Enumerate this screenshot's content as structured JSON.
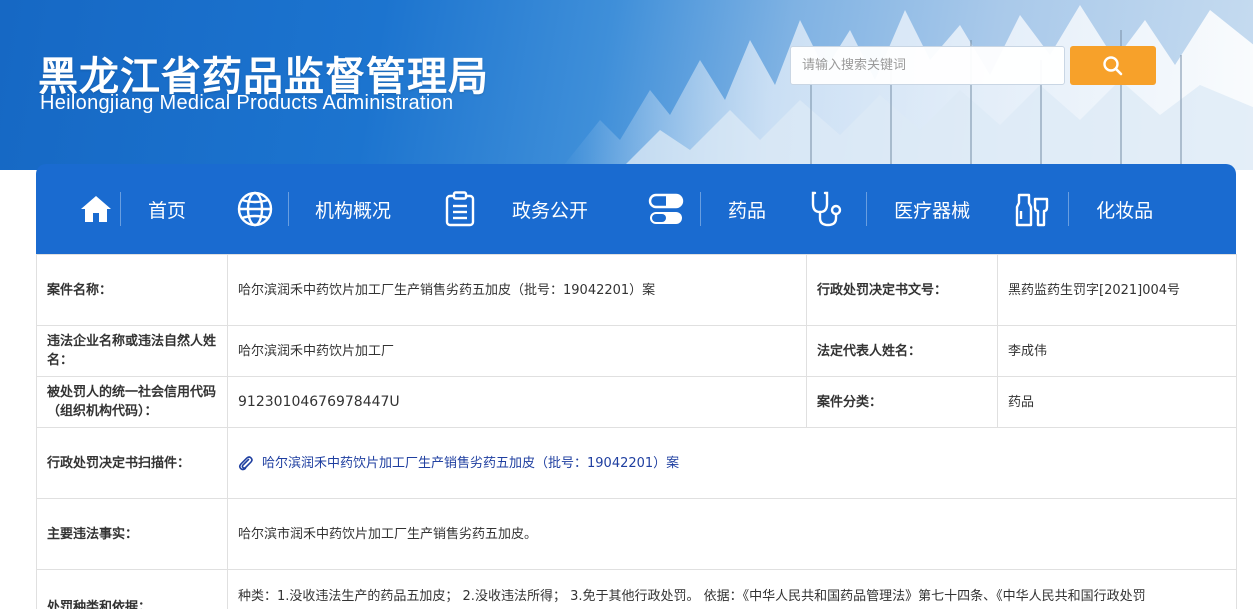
{
  "header": {
    "title_cn": "黑龙江省药品监督管理局",
    "title_en": "Heilongjiang Medical Products Administration",
    "search_placeholder": "请输入搜索关键词"
  },
  "nav": [
    {
      "label": "首页",
      "icon": "home-icon"
    },
    {
      "label": "机构概况",
      "icon": "globe-icon"
    },
    {
      "label": "政务公开",
      "icon": "clipboard-icon"
    },
    {
      "label": "药品",
      "icon": "pill-icon"
    },
    {
      "label": "医疗器械",
      "icon": "stethoscope-icon"
    },
    {
      "label": "化妆品",
      "icon": "cosmetics-icon"
    }
  ],
  "case": {
    "name_key": "案件名称：",
    "name_val": "哈尔滨润禾中药饮片加工厂生产销售劣药五加皮（批号：19042201）案",
    "docno_key": "行政处罚决定书文号：",
    "docno_val": "黑药监药生罚字[2021]004号",
    "company_key": "违法企业名称或违法自然人姓名：",
    "company_val": "哈尔滨润禾中药饮片加工厂",
    "rep_key": "法定代表人姓名：",
    "rep_val": "李成伟",
    "credit_key": "被处罚人的统一社会信用代码（组织机构代码）：",
    "credit_val": "91230104676978447U",
    "category_key": "案件分类：",
    "category_val": "药品",
    "scan_key": "行政处罚决定书扫描件：",
    "scan_val": "哈尔滨润禾中药饮片加工厂生产销售劣药五加皮（批号：19042201）案",
    "facts_key": "主要违法事实：",
    "facts_val": "哈尔滨市润禾中药饮片加工厂生产销售劣药五加皮。",
    "penalty_key": "处罚种类和依据：",
    "penalty_val": "种类：1.没收违法生产的药品五加皮； 2.没收违法所得； 3.免于其他行政处罚。 依据：《中华人民共和国药品管理法》第七十四条、《中华人民共和国行政处罚"
  },
  "colors": {
    "nav_bg": "#1a6bd0",
    "search_button": "#f7a12a",
    "link": "#1f3fa0"
  }
}
